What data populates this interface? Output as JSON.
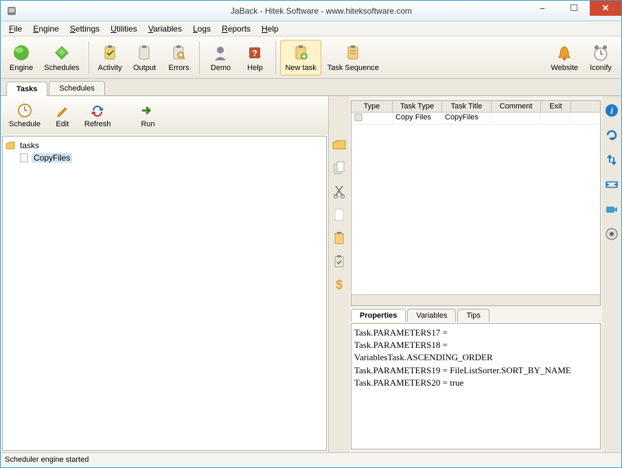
{
  "title": "JaBack    - Hitek Software - www.hiteksoftware.com",
  "menubar": [
    "File",
    "Engine",
    "Settings",
    "Utilities",
    "Variables",
    "Logs",
    "Reports",
    "Help"
  ],
  "toolbar": {
    "engine": "Engine",
    "schedules": "Schedules",
    "activity": "Activity",
    "output": "Output",
    "errors": "Errors",
    "demo": "Demo",
    "help": "Help",
    "newtask": "New task",
    "tasksequence": "Task Sequence",
    "website": "Website",
    "iconify": "Iconify"
  },
  "tabs": {
    "tasks": "Tasks",
    "schedules": "Schedules"
  },
  "lefttoolbar": {
    "schedule": "Schedule",
    "edit": "Edit",
    "refresh": "Refresh",
    "run": "Run"
  },
  "tree": {
    "root": "tasks",
    "child": "CopyFiles"
  },
  "grid": {
    "headers": [
      "Type",
      "Task Type",
      "Task Title",
      "Comment",
      "Exit"
    ],
    "row": {
      "tasktype": "Copy Files",
      "tasktitle": "CopyFiles",
      "comment": "",
      "exit": ""
    }
  },
  "proptabs": {
    "properties": "Properties",
    "variables": "Variables",
    "tips": "Tips"
  },
  "properties": [
    "Task.PARAMETERS17 =",
    "Task.PARAMETERS18 =",
    "VariablesTask.ASCENDING_ORDER",
    "Task.PARAMETERS19 = FileListSorter.SORT_BY_NAME",
    "Task.PARAMETERS20 = true"
  ],
  "status": "Scheduler engine started"
}
